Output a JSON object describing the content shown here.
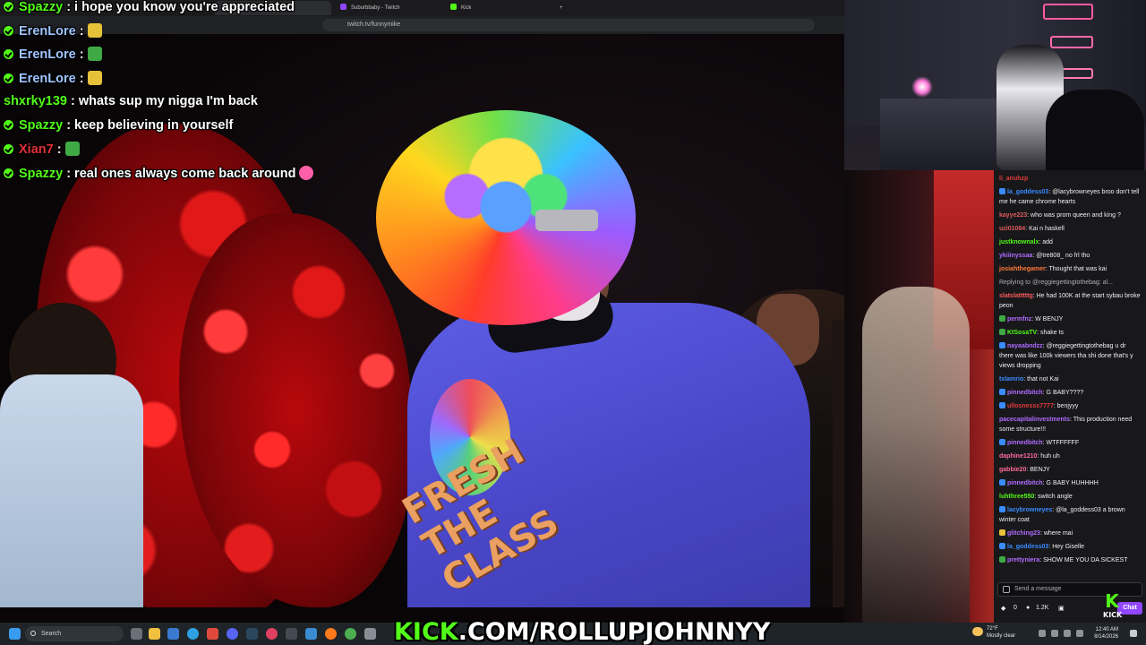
{
  "browser": {
    "tabs": [
      {
        "label": "twitch",
        "color": "#9147ff"
      },
      {
        "label": "Suburbbaby - Twitch",
        "color": "#9147ff"
      },
      {
        "label": "Kick",
        "color": "#53fc18"
      }
    ],
    "new_tab_label": "+",
    "url": "twitch.tv/funnymike"
  },
  "overlay_chat": [
    {
      "user": "Spazzy",
      "user_color": "#53fc18",
      "text": " : i hope you know you're appreciated",
      "emote": ""
    },
    {
      "user": "ErenLore",
      "user_color": "#9fc4ff",
      "text": " :",
      "emote": "#e6c23a"
    },
    {
      "user": "ErenLore",
      "user_color": "#9fc4ff",
      "text": " :",
      "emote": "#3faa45"
    },
    {
      "user": "ErenLore",
      "user_color": "#9fc4ff",
      "text": " :",
      "emote": "#e6c23a"
    },
    {
      "user": "shxrky139",
      "user_color": "#53fc18",
      "text": " : whats sup my nigga I'm back",
      "emote": ""
    },
    {
      "user": "Spazzy",
      "user_color": "#53fc18",
      "text": " : keep believing in yourself",
      "emote": ""
    },
    {
      "user": "Xian7",
      "user_color": "#e0303a",
      "text": " :",
      "emote": "#3faa45"
    },
    {
      "user": "Spazzy",
      "user_color": "#53fc18",
      "text": " : real ones always come back around",
      "emote": "#ff5fa8"
    }
  ],
  "jacket_text": "FRESH THE CLASS",
  "chat": {
    "messages": [
      {
        "user": "li_anuhzp",
        "color": "#e03a3a",
        "text": "",
        "badge": ""
      },
      {
        "user": "la_goddess03",
        "color": "#3a8cff",
        "text": ": @lacybrowneyes broo don't tell me he came chrome hearts",
        "badge": "#3a8cff"
      },
      {
        "user": "kayye223",
        "color": "#e05a5a",
        "text": ": who was prom queen and king ?",
        "badge": ""
      },
      {
        "user": "uzi01084",
        "color": "#e05a5a",
        "text": ": Kai n haskell",
        "badge": ""
      },
      {
        "user": "justknownalx",
        "color": "#53fc18",
        "text": ": add",
        "badge": ""
      },
      {
        "user": "ykiiinyssaa",
        "color": "#b06bff",
        "text": ": @tre808_ no frl tho",
        "badge": ""
      },
      {
        "user": "josiahthegamer",
        "color": "#ff7a3a",
        "text": ": Thought that was kai",
        "badge": ""
      },
      {
        "user": "",
        "color": "#adadb8",
        "text": "Replying to @reggiegettingtothebag: al...",
        "badge": ""
      },
      {
        "user": "slatslatttttg",
        "color": "#ff5a5a",
        "text": ": He had 100K at the start sybau broke peon",
        "badge": ""
      },
      {
        "user": "permfnz",
        "color": "#b06bff",
        "text": ": W BENJY",
        "badge": "#3faa45"
      },
      {
        "user": "KtSosaTV",
        "color": "#53fc18",
        "text": ": shake ts",
        "badge": "#3faa45"
      },
      {
        "user": "nayaabndzz",
        "color": "#b06bff",
        "text": ": @reggiegettingtothebag u dr there was like 100k viewers tha shi done that's y views dropping",
        "badge": "#3a8cff"
      },
      {
        "user": "txlamrio",
        "color": "#3a8cff",
        "text": ": that not Kai",
        "badge": ""
      },
      {
        "user": "pinnedbitch",
        "color": "#b06bff",
        "text": ": G BABY????",
        "badge": "#3a8cff"
      },
      {
        "user": "ullosnesss7777",
        "color": "#e03a3a",
        "text": ": benjyyy",
        "badge": "#3a8cff"
      },
      {
        "user": "pacecapitalinvestments",
        "color": "#b06bff",
        "text": ": This production need some structure!!!",
        "badge": ""
      },
      {
        "user": "pinnedbitch",
        "color": "#b06bff",
        "text": ": WTFFFFFF",
        "badge": "#3a8cff"
      },
      {
        "user": "daphine1210",
        "color": "#ff6a9a",
        "text": ": huh uh",
        "badge": ""
      },
      {
        "user": "gabbie20",
        "color": "#ff6a9a",
        "text": ": BENJY",
        "badge": ""
      },
      {
        "user": "pinnedbitch",
        "color": "#b06bff",
        "text": ": G BABY HUHHHH",
        "badge": "#3a8cff"
      },
      {
        "user": "luhthree550",
        "color": "#53fc18",
        "text": ": switch angle",
        "badge": ""
      },
      {
        "user": "lacybrowneyes",
        "color": "#3a8cff",
        "text": ": @la_goddess03 a brown winter coat",
        "badge": "#3a8cff"
      },
      {
        "user": "glitching23",
        "color": "#b06bff",
        "text": ": where mai",
        "badge": "#e6c23a"
      },
      {
        "user": "la_goddess03",
        "color": "#3a8cff",
        "text": ": Hey Giselle",
        "badge": "#3a8cff"
      },
      {
        "user": "prettyniera",
        "color": "#b06bff",
        "text": ": SHOW ME YOU DA SICKEST",
        "badge": "#3faa45"
      }
    ],
    "input_placeholder": "Send a message",
    "points": "0",
    "viewers": "1.2K",
    "send_label": "Chat"
  },
  "kick_small": {
    "logo": "K",
    "label": "KICK"
  },
  "banner": {
    "prefix": "KICK",
    "rest": ".COM/ROLLUPJOHNNYY"
  },
  "taskbar": {
    "search_label": "Search",
    "weather_temp": "72°F",
    "weather_desc": "Mostly clear",
    "time": "12:40 AM",
    "date": "8/14/2026"
  }
}
